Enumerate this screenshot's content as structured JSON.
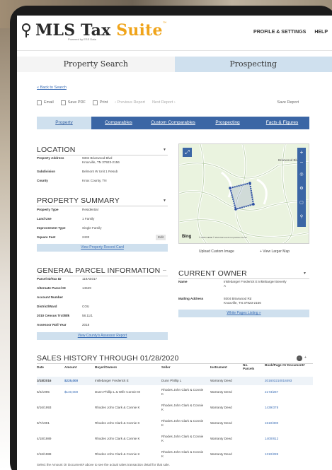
{
  "app": {
    "logo_main": "MLS Tax ",
    "logo_accent": "Suite",
    "logo_tm": "™",
    "logo_sub": "Powered by ESS Data"
  },
  "nav": {
    "profile": "PROFILE & SETTINGS",
    "help": "HELP"
  },
  "main_tabs": [
    "Property Search",
    "Prospecting"
  ],
  "back_link": "« Back to Search",
  "toolbar": {
    "email": "Email",
    "save_pdf": "Save PDF",
    "print": "Print",
    "prev": "‹ Previous Report",
    "next": "Next Report ›",
    "save_report": "Save Report"
  },
  "subtabs": [
    "Property",
    "Comparables",
    "Custom Comparables",
    "Prospecting",
    "Facts & Figures"
  ],
  "location": {
    "title": "LOCATION",
    "rows": [
      {
        "k": "Property Address",
        "v": "9304 Briarwood Blvd",
        "v2": "Knoxville, TN 37923-2156"
      },
      {
        "k": "Subdivision",
        "v": "Belmont W Unit 1 Resub"
      },
      {
        "k": "County",
        "v": "Knox County, TN"
      }
    ]
  },
  "summary": {
    "title": "PROPERTY SUMMARY",
    "rows": [
      {
        "k": "Property Type",
        "v": "Residential"
      },
      {
        "k": "Land Use",
        "v": "1 Family"
      },
      {
        "k": "Improvement Type",
        "v": "Single Family"
      },
      {
        "k": "Square Feet",
        "v": "2433"
      }
    ],
    "edit": "Edit",
    "button": "View Property Record Card"
  },
  "parcel": {
    "title": "GENERAL PARCEL INFORMATION",
    "rows": [
      {
        "k": "Parcel ID/Tax ID",
        "v": "119AE017"
      },
      {
        "k": "Alternate Parcel ID",
        "v": "14529"
      },
      {
        "k": "Account Number",
        "v": ""
      },
      {
        "k": "District/Ward",
        "v": "COU"
      },
      {
        "k": "2010 Census Trct/Blk",
        "v": "58.11/1"
      },
      {
        "k": "Assessor Roll Year",
        "v": "2018"
      }
    ],
    "button": "View County's Assessor Report"
  },
  "map": {
    "links": [
      "Upload Custom Image",
      "+ View Larger Map"
    ],
    "brand": "Bing",
    "street": "Briarwood Blvd",
    "copyright": "© 2020 HERE  © 2020 Microsoft Corporation  Terms"
  },
  "owner": {
    "title": "CURRENT OWNER",
    "rows": [
      {
        "k": "Name",
        "v": "Inklebarger Frederick E Inklebarger Beverly",
        "v2": "A"
      },
      {
        "k": "Mailing Address",
        "v": "9304 Briarwood Rd",
        "v2": "Knoxville, TN 37923-2156"
      }
    ],
    "button": "White Pages Listing »"
  },
  "sales": {
    "title": "SALES HISTORY THROUGH 01/28/2020",
    "headers": [
      "Date",
      "Amount",
      "Buyer/Owners",
      "Seller",
      "Instrument",
      "No. Parcels",
      "Book/Page Or Document#"
    ],
    "rows": [
      {
        "date": "3/18/2016",
        "amount": "$225,000",
        "buyer": "Inklebarger Frederick E",
        "seller": "Dunn Phillip L",
        "instrument": "Warranty Deed",
        "parcels": "",
        "doc": "201603210018493"
      },
      {
        "date": "6/2/1995",
        "amount": "$140,000",
        "buyer": "Dunn Phillip L & Wife Connie M",
        "seller": "Rhodes John Clark & Connie K",
        "instrument": "Warranty Deed",
        "parcels": "",
        "doc": "2173/287"
      },
      {
        "date": "8/16/1993",
        "amount": "",
        "buyer": "Rhodes John Clark & Connie K",
        "seller": "Rhodes John Clark & Connie K",
        "instrument": "Warranty Deed",
        "parcels": "",
        "doc": "1439/378"
      },
      {
        "date": "9/7/1991",
        "amount": "",
        "buyer": "Rhodes John Clark & Connie K",
        "seller": "Rhodes John Clark & Connie K",
        "instrument": "Warranty Deed",
        "parcels": "",
        "doc": "1510/300"
      },
      {
        "date": "4/18/1989",
        "amount": "",
        "buyer": "Rhodes John Clark & Connie K",
        "seller": "Rhodes John Clark & Connie K",
        "instrument": "Warranty Deed",
        "parcels": "",
        "doc": "1400/812"
      },
      {
        "date": "2/16/1988",
        "amount": "",
        "buyer": "Rhodes John Clark & Connie K",
        "seller": "Rhodes John Clark & Connie K",
        "instrument": "Warranty Deed",
        "parcels": "",
        "doc": "1310/289"
      }
    ],
    "note": "Select the Amount Or Document# above to see the actual sales transaction detail for that sale."
  },
  "colors": {
    "accent": "#f0a41a",
    "nav_blue": "#3b66a5",
    "light_blue": "#cfe0ee"
  }
}
